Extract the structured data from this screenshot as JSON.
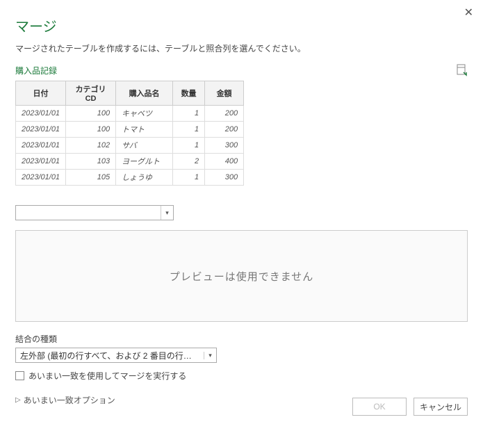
{
  "title": "マージ",
  "description": "マージされたテーブルを作成するには、テーブルと照合列を選んでください。",
  "source_name": "購入品記録",
  "table": {
    "headers": [
      "日付",
      "カテゴリCD",
      "購入品名",
      "数量",
      "金額"
    ],
    "rows": [
      {
        "date": "2023/01/01",
        "cat": "100",
        "name": "キャベツ",
        "qty": "1",
        "amt": "200"
      },
      {
        "date": "2023/01/01",
        "cat": "100",
        "name": "トマト",
        "qty": "1",
        "amt": "200"
      },
      {
        "date": "2023/01/01",
        "cat": "102",
        "name": "サバ",
        "qty": "1",
        "amt": "300"
      },
      {
        "date": "2023/01/01",
        "cat": "103",
        "name": "ヨーグルト",
        "qty": "2",
        "amt": "400"
      },
      {
        "date": "2023/01/01",
        "cat": "105",
        "name": "しょうゆ",
        "qty": "1",
        "amt": "300"
      }
    ]
  },
  "second_source": "",
  "preview_message": "プレビューは使用できません",
  "join_type_label": "結合の種類",
  "join_type_value": "左外部 (最初の行すべて、および 2 番目の行のうち一…",
  "fuzzy_checkbox_label": "あいまい一致を使用してマージを実行する",
  "fuzzy_options_label": "あいまい一致オプション",
  "buttons": {
    "ok": "OK",
    "cancel": "キャンセル"
  }
}
